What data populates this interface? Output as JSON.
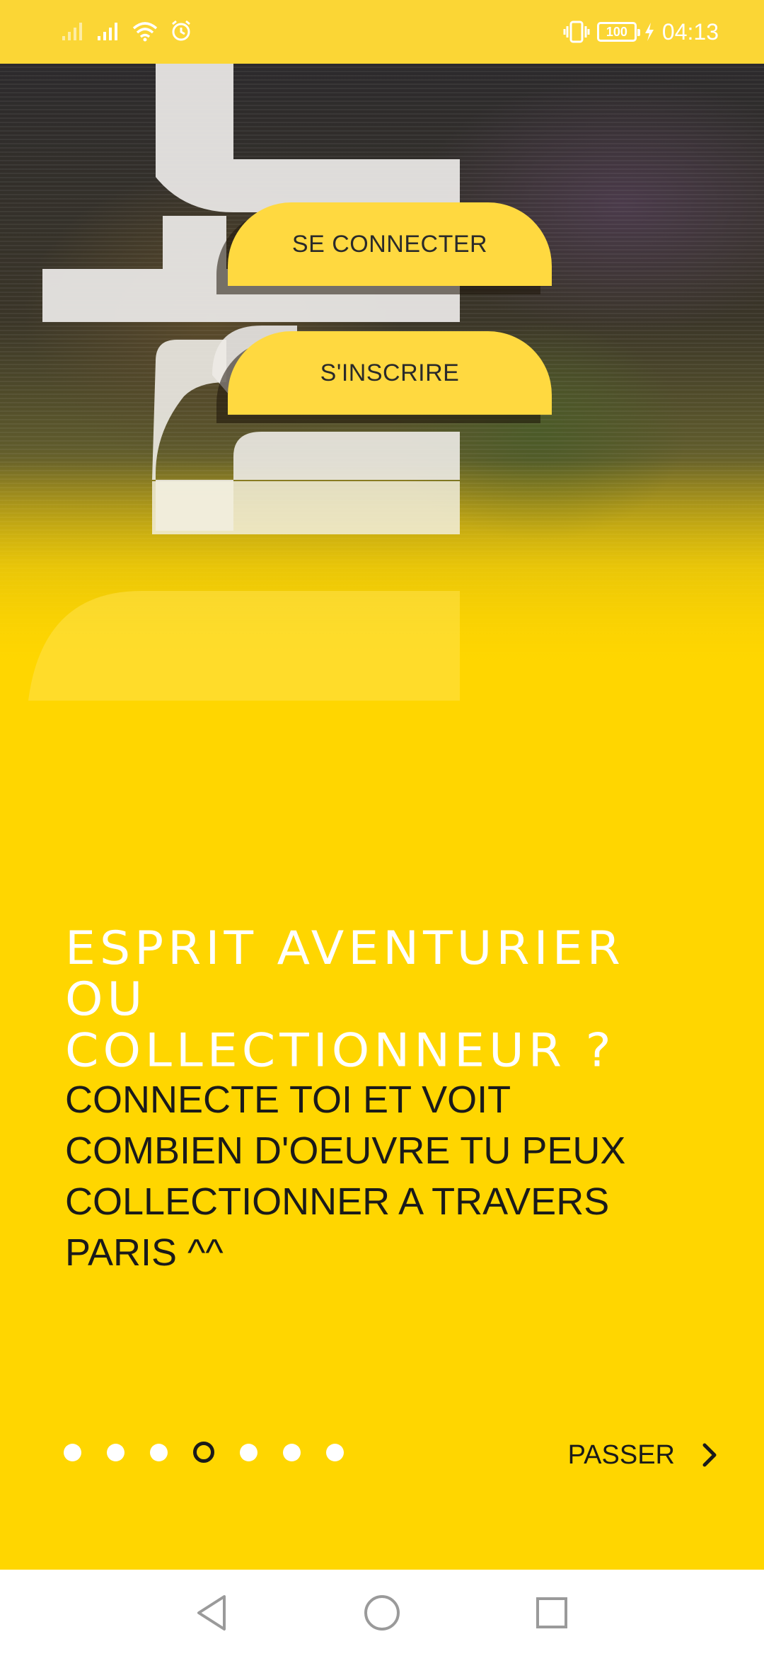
{
  "status_bar": {
    "time": "04:13",
    "battery_level": "100",
    "icons": [
      "signal-icon",
      "signal-icon",
      "wifi-icon",
      "alarm-icon",
      "vibrate-icon",
      "battery-icon",
      "charging-icon"
    ]
  },
  "auth": {
    "login_label": "SE CONNECTER",
    "register_label": "S'INSCRIRE"
  },
  "onboarding": {
    "headline_line1": "ESPRIT AVENTURIER OU",
    "headline_line2": "COLLECTIONNEUR ?",
    "description_lines": [
      "CONNECTE TOI ET VOIT",
      "COMBIEN D'OEUVRE TU PEUX",
      "COLLECTIONNER A TRAVERS",
      "PARIS ^^"
    ]
  },
  "pager": {
    "total_pages": 7,
    "current_page": 4
  },
  "skip": {
    "label": "PASSER",
    "icon": "chevron-right-icon"
  },
  "nav_bar": {
    "icons": [
      "back-icon",
      "home-icon",
      "recents-icon"
    ]
  },
  "colors": {
    "accent": "#FFD600",
    "button": "#FFD940",
    "status_bar": "#FBD635",
    "text_dark": "#1a1a1a",
    "text_light": "#ffffff"
  }
}
